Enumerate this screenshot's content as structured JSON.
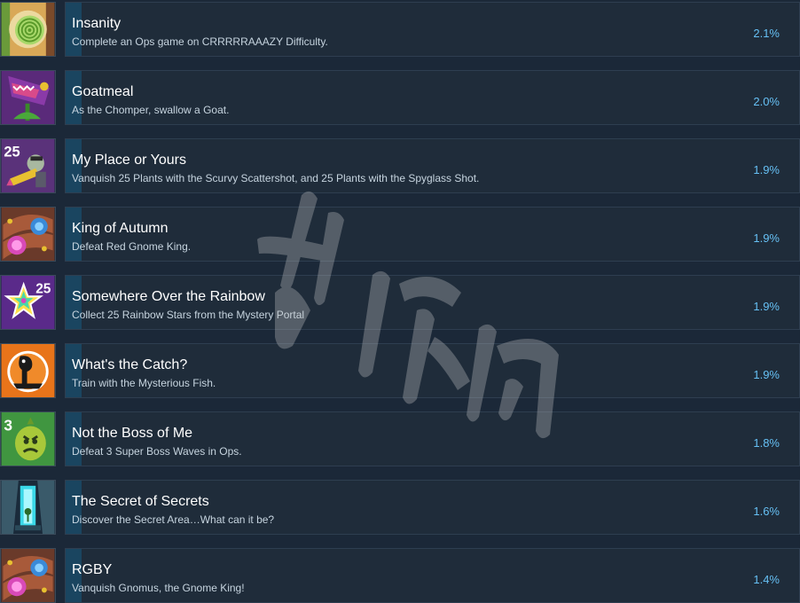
{
  "achievements": [
    {
      "title": "Insanity",
      "description": "Complete an Ops game on CRRRRRAAAZY Difficulty.",
      "percent": "2.1%",
      "icon": "hypnotized-eye-icon"
    },
    {
      "title": "Goatmeal",
      "description": "As the Chomper, swallow a Goat.",
      "percent": "2.0%",
      "icon": "chomper-icon"
    },
    {
      "title": "My Place or Yours",
      "description": "Vanquish 25 Plants with the Scurvy Scattershot, and 25 Plants with the Spyglass Shot.",
      "percent": "1.9%",
      "icon": "pirate-zombie-icon",
      "badge": "25"
    },
    {
      "title": "King of Autumn",
      "description": "Defeat Red Gnome King.",
      "percent": "1.9%",
      "icon": "portal-orbs-icon"
    },
    {
      "title": "Somewhere Over the Rainbow",
      "description": "Collect 25 Rainbow Stars from the Mystery Portal",
      "percent": "1.9%",
      "icon": "rainbow-star-icon",
      "badge": "25"
    },
    {
      "title": "What's the Catch?",
      "description": "Train with the Mysterious Fish.",
      "percent": "1.9%",
      "icon": "mysterious-fish-icon"
    },
    {
      "title": "Not the Boss of Me",
      "description": "Defeat 3 Super Boss Waves in Ops.",
      "percent": "1.8%",
      "icon": "boss-plant-icon",
      "badge": "3"
    },
    {
      "title": "The Secret of Secrets",
      "description": "Discover the Secret Area…What can it be?",
      "percent": "1.6%",
      "icon": "secret-area-icon"
    },
    {
      "title": "RGBY",
      "description": "Vanquish Gnomus, the Gnome King!",
      "percent": "1.4%",
      "icon": "portal-orbs-icon"
    }
  ],
  "colors": {
    "background": "#1b2838",
    "panel": "#1f2c3a",
    "bar": "#1a4560",
    "percent": "#66c0f4",
    "title": "#ffffff",
    "description": "#c6d4df"
  }
}
